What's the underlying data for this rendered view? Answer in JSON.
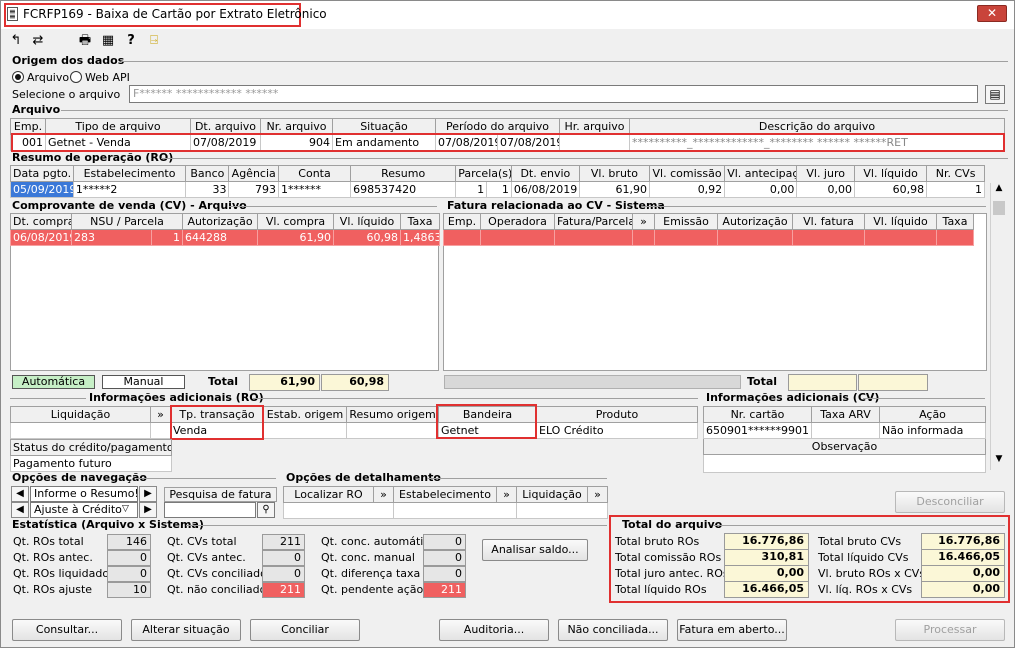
{
  "window": {
    "title": "FCRFP169 - Baixa de Cartão por Extrato Eletrônico",
    "close": "✕"
  },
  "toolbar": {
    "icons": [
      "↰",
      "⇄",
      "🖶",
      "▦",
      "?",
      "⍈"
    ]
  },
  "origem": {
    "title": "Origem dos dados",
    "opt1": "Arquivo",
    "opt2": "Web API",
    "select_label": "Selecione o arquivo",
    "file_value": "F****** ************ ******",
    "browse": "▤"
  },
  "arquivo": {
    "title": "Arquivo",
    "headers": [
      "Emp.",
      "Tipo de arquivo",
      "Dt. arquivo",
      "Nr. arquivo",
      "Situação",
      "Período do arquivo",
      "",
      "Hr. arquivo",
      "Descrição do arquivo"
    ],
    "row": [
      "001",
      "Getnet - Venda",
      "07/08/2019",
      "904",
      "Em andamento",
      "07/08/2019",
      "07/08/2019",
      "",
      "**********_*************_******** ****** ******RET"
    ]
  },
  "ro": {
    "title": "Resumo de operação (RO)",
    "headers": [
      "Data pgto.",
      "Estabelecimento",
      "Banco",
      "Agência",
      "Conta",
      "Resumo",
      "Parcela(s)",
      "Dt. envio",
      "Vl. bruto",
      "Vl. comissão",
      "Vl. antecipação",
      "Vl. juro",
      "Vl. líquido",
      "Nr. CVs"
    ],
    "row": [
      "05/09/2019",
      "1*****2",
      "33",
      "793",
      "1******",
      "698537420",
      "1",
      "1",
      "06/08/2019",
      "61,90",
      "0,92",
      "0,00",
      "0,00",
      "60,98",
      "1"
    ]
  },
  "cv": {
    "title": "Comprovante de venda (CV) - Arquivo",
    "headers": [
      "Dt. compra",
      "NSU / Parcela",
      "",
      "Autorização",
      "Vl. compra",
      "Vl. líquido",
      "Taxa"
    ],
    "row": [
      "06/08/2019",
      "283",
      "1",
      "644288",
      "61,90",
      "60,98",
      "1,4863"
    ],
    "auto": "Automática",
    "manual": "Manual",
    "total_label": "Total",
    "total_compra": "61,90",
    "total_liquido": "60,98"
  },
  "fatura": {
    "title": "Fatura relacionada ao CV - Sistema",
    "headers": [
      "Emp.",
      "Operadora",
      "Fatura/Parcela",
      "»",
      "Emissão",
      "Autorização",
      "Vl. fatura",
      "Vl. líquido",
      "Taxa"
    ],
    "total_label": "Total"
  },
  "info_ro": {
    "title": "Informações adicionais (RO)",
    "headers": [
      "Liquidação",
      "»",
      "Tp. transação",
      "Estab. origem",
      "Resumo origem",
      "Bandeira",
      "Produto"
    ],
    "row": [
      "",
      "",
      "Venda",
      "",
      "",
      "Getnet",
      "ELO Crédito"
    ],
    "status_label": "Status do crédito/pagamento",
    "status_value": "Pagamento futuro"
  },
  "info_cv": {
    "title": "Informações adicionais (CV)",
    "headers": [
      "Nr. cartão",
      "Taxa ARV",
      "Ação"
    ],
    "row": [
      "650901******9901",
      "",
      "Não informada"
    ],
    "obs_label": "Observação"
  },
  "nav": {
    "title": "Opções de navegação",
    "item1": "Informe o Resumo!",
    "item2": "Ajuste à Crédito",
    "pesquisa": "Pesquisa de fatura"
  },
  "detalhe": {
    "title": "Opções de detalhamento",
    "cols": [
      "Localizar RO",
      "»",
      "Estabelecimento",
      "»",
      "Liquidação",
      "»"
    ]
  },
  "estat": {
    "title": "Estatística (Arquivo x Sistema)",
    "col1": [
      {
        "l": "Qt. ROs total",
        "v": "146"
      },
      {
        "l": "Qt. ROs antec.",
        "v": "0"
      },
      {
        "l": "Qt. ROs liquidados",
        "v": "0"
      },
      {
        "l": "Qt. ROs ajuste",
        "v": "10"
      }
    ],
    "col2": [
      {
        "l": "Qt. CVs total",
        "v": "211"
      },
      {
        "l": "Qt. CVs antec.",
        "v": "0"
      },
      {
        "l": "Qt. CVs conciliado",
        "v": "0"
      },
      {
        "l": "Qt. não conciliado",
        "v": "211"
      }
    ],
    "col3": [
      {
        "l": "Qt. conc. automático",
        "v": "0"
      },
      {
        "l": "Qt. conc. manual",
        "v": "0"
      },
      {
        "l": "Qt. diferença taxa",
        "v": "0"
      },
      {
        "l": "Qt. pendente ação",
        "v": "211"
      }
    ],
    "analisar": "Analisar saldo..."
  },
  "total": {
    "title": "Total do arquivo",
    "left": [
      {
        "l": "Total bruto ROs",
        "v": "16.776,86"
      },
      {
        "l": "Total comissão ROs",
        "v": "310,81"
      },
      {
        "l": "Total juro antec. ROs",
        "v": "0,00"
      },
      {
        "l": "Total líquido ROs",
        "v": "16.466,05"
      }
    ],
    "right": [
      {
        "l": "Total bruto CVs",
        "v": "16.776,86"
      },
      {
        "l": "Total líquido CVs",
        "v": "16.466,05"
      },
      {
        "l": "Vl. bruto ROs x CVs",
        "v": "0,00"
      },
      {
        "l": "Vl. líq. ROs x CVs",
        "v": "0,00"
      }
    ],
    "desconciliar": "Desconciliar"
  },
  "buttons": {
    "consultar": "Consultar...",
    "alterar": "Alterar situação",
    "conciliar": "Conciliar",
    "auditoria": "Auditoria...",
    "nao_conciliada": "Não conciliada...",
    "fatura_aberto": "Fatura em aberto...",
    "processar": "Processar"
  },
  "colors": {
    "red_row": "#f06060",
    "highlight": "#e03030",
    "total_bg": "#fbf7d7",
    "auto_bg": "#c6efc6"
  }
}
